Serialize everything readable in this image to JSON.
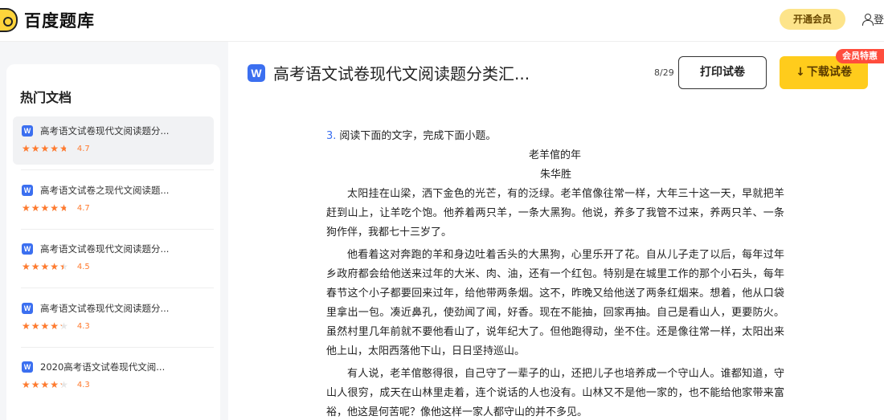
{
  "app": {
    "logo_text": "百度题库",
    "vip_label": "开通会员",
    "login_label": "登"
  },
  "sidebar": {
    "title": "热门文档",
    "items": [
      {
        "name": "高考语文试卷现代文阅读题分...",
        "rating": 4.7,
        "score": "4.7",
        "active": true
      },
      {
        "name": "高考语文试卷之现代文阅读题...",
        "rating": 4.7,
        "score": "4.7",
        "active": false
      },
      {
        "name": "高考语文试卷现代文阅读题分...",
        "rating": 4.5,
        "score": "4.5",
        "active": false
      },
      {
        "name": "高考语文试卷现代文阅读题分...",
        "rating": 4.3,
        "score": "4.3",
        "active": false
      },
      {
        "name": "2020高考语文试卷现代文阅...",
        "rating": 4.3,
        "score": "4.3",
        "active": false
      }
    ]
  },
  "header": {
    "file_icon": "W",
    "title": "高考语文试卷现代文阅读题分类汇...",
    "page_count": "8/29",
    "print_label": "打印试卷",
    "download_label": "下载试卷",
    "badge": "会员特惠"
  },
  "document": {
    "question_number": "3.",
    "question": "阅读下面的文字，完成下面小题。",
    "story_title": "老羊倌的年",
    "author": "朱华胜",
    "paragraphs": [
      "太阳挂在山梁，洒下金色的光芒，有的泛绿。老羊倌像往常一样，大年三十这一天，早就把羊赶到山上，让羊吃个饱。他养着两只羊，一条大黑狗。他说，养多了我管不过来，养两只羊、一条狗作伴，我都七十三岁了。",
      "他看着这对奔跑的羊和身边吐着舌头的大黑狗，心里乐开了花。自从儿子走了以后，每年过年乡政府都会给他送来过年的大米、肉、油，还有一个红包。特别是在城里工作的那个小石头，每年春节这个小子都要回来过年，给他带两条烟。这不，昨晚又给他送了两条红烟来。想着，他从口袋里拿出一包。凑近鼻孔，使劲闻了闻，好香。现在不能抽，回家再抽。自己是看山人，更要防火。虽然村里几年前就不要他看山了，说年纪大了。但他跑得动，坐不住。还是像往常一样，太阳出来他上山，太阳西落他下山，日日坚持巡山。",
      "有人说，老羊倌憨得很，自己守了一辈子的山，还把儿子也培养成一个守山人。谁都知道，守山人很穷，成天在山林里走着，连个说话的人也没有。山林又不是他一家的，也不能给他家带来富裕，他这是何苦呢？像他这样一家人都守山的并不多见。"
    ]
  },
  "colors": {
    "accent_blue": "#3b6ff0",
    "star_orange": "#ff7a2e",
    "download_yellow": "#ffcc1c",
    "badge_red": "#ff4d3d"
  }
}
